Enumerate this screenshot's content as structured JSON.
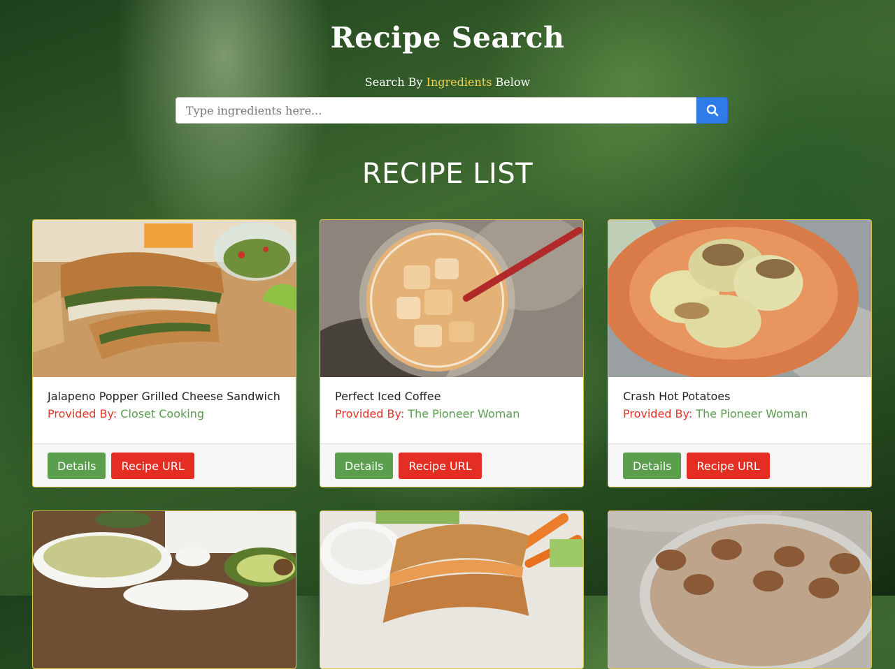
{
  "header": {
    "title": "Recipe Search",
    "subtitle_prefix": "Search By ",
    "subtitle_highlight": "Ingredients",
    "subtitle_suffix": " Below"
  },
  "search": {
    "value": "",
    "placeholder": "Type ingredients here...",
    "button_icon": "search-icon"
  },
  "list_title": "RECIPE LIST",
  "cards": [
    {
      "title": "Jalapeno Popper Grilled Cheese Sandwich",
      "provided_by_label": "Provided By: ",
      "source": "Closet Cooking",
      "details_label": "Details",
      "url_label": "Recipe URL",
      "image_desc": "grilled-cheese-sandwich"
    },
    {
      "title": "Perfect Iced Coffee",
      "provided_by_label": "Provided By: ",
      "source": "The Pioneer Woman",
      "details_label": "Details",
      "url_label": "Recipe URL",
      "image_desc": "iced-coffee"
    },
    {
      "title": "Crash Hot Potatoes",
      "provided_by_label": "Provided By: ",
      "source": "The Pioneer Woman",
      "details_label": "Details",
      "url_label": "Recipe URL",
      "image_desc": "crash-hot-potatoes"
    },
    {
      "title": "",
      "provided_by_label": "",
      "source": "",
      "details_label": "",
      "url_label": "",
      "image_desc": "pasta-with-avocado"
    },
    {
      "title": "",
      "provided_by_label": "",
      "source": "",
      "details_label": "",
      "url_label": "",
      "image_desc": "grilled-sandwich"
    },
    {
      "title": "",
      "provided_by_label": "",
      "source": "",
      "details_label": "",
      "url_label": "",
      "image_desc": "cinnamon-rolls"
    }
  ],
  "colors": {
    "highlight": "#f2d34e",
    "search_button": "#2f7be8",
    "details_button": "#5a9e4e",
    "url_button": "#e42e24",
    "provider_label": "#e2362a",
    "provider_source": "#5a9e4e",
    "card_border": "#d8c44a"
  }
}
